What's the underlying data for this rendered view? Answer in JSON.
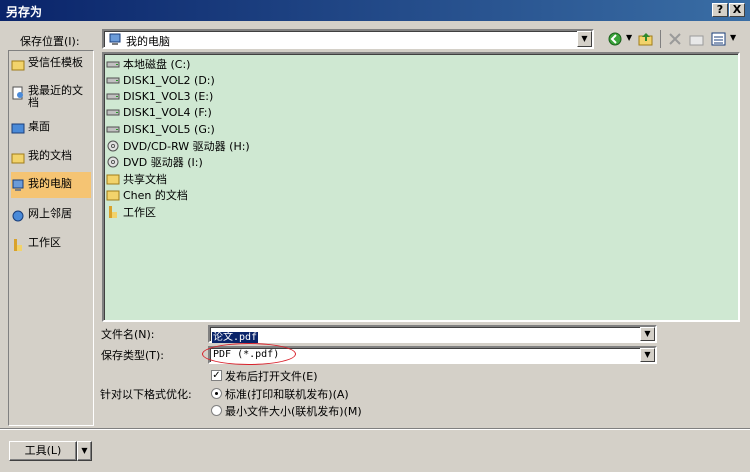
{
  "window": {
    "title": "另存为",
    "help": "?",
    "close": "X"
  },
  "location": {
    "label": "保存位置(I):",
    "value": "我的电脑"
  },
  "sidebar": {
    "items": [
      {
        "label": "受信任模板",
        "icon": "folder-icon"
      },
      {
        "label": "我最近的文档",
        "icon": "recent-docs-icon"
      },
      {
        "label": "桌面",
        "icon": "desktop-icon"
      },
      {
        "label": "我的文档",
        "icon": "my-documents-icon"
      },
      {
        "label": "我的电脑",
        "icon": "my-computer-icon",
        "selected": true
      },
      {
        "label": "网上邻居",
        "icon": "network-icon"
      },
      {
        "label": "工作区",
        "icon": "workspace-icon"
      }
    ]
  },
  "files": [
    {
      "label": "本地磁盘 (C:)",
      "icon": "drive-icon"
    },
    {
      "label": "DISK1_VOL2 (D:)",
      "icon": "drive-icon"
    },
    {
      "label": "DISK1_VOL3 (E:)",
      "icon": "drive-icon"
    },
    {
      "label": "DISK1_VOL4 (F:)",
      "icon": "drive-icon"
    },
    {
      "label": "DISK1_VOL5 (G:)",
      "icon": "drive-icon"
    },
    {
      "label": "DVD/CD-RW 驱动器 (H:)",
      "icon": "dvd-drive-icon"
    },
    {
      "label": "DVD 驱动器 (I:)",
      "icon": "dvd-drive-icon"
    },
    {
      "label": "共享文档",
      "icon": "folder-icon"
    },
    {
      "label": "Chen 的文档",
      "icon": "folder-icon"
    },
    {
      "label": "工作区",
      "icon": "workspace-icon"
    }
  ],
  "form": {
    "filename_label": "文件名(N):",
    "filename_value": "论文.pdf",
    "filetype_label": "保存类型(T):",
    "filetype_value": "PDF (*.pdf)",
    "open_after_publish": "发布后打开文件(E)",
    "optimize_label": "针对以下格式优化:",
    "option_standard": "标准(打印和联机发布)(A)",
    "option_minimum": "最小文件大小(联机发布)(M)"
  },
  "footer": {
    "tools_label": "工具(L)"
  }
}
